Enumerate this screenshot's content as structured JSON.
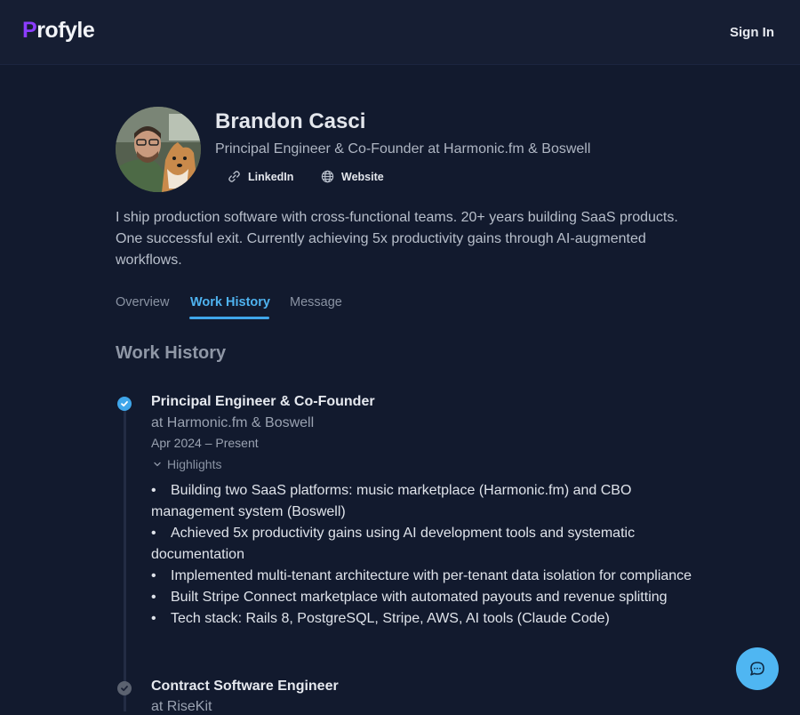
{
  "header": {
    "logo_first": "P",
    "logo_rest": "rofyle",
    "signin_label": "Sign In"
  },
  "profile": {
    "name": "Brandon Casci",
    "role": "Principal Engineer & Co-Founder at Harmonic.fm & Boswell",
    "links": [
      {
        "label": "LinkedIn",
        "icon": "link-icon"
      },
      {
        "label": "Website",
        "icon": "globe-icon"
      }
    ],
    "bio": "I ship production software with cross-functional teams. 20+ years building SaaS products. One successful exit. Currently achieving 5x productivity gains through AI-augmented workflows."
  },
  "tabs": [
    {
      "label": "Overview",
      "active": false
    },
    {
      "label": "Work History",
      "active": true
    },
    {
      "label": "Message",
      "active": false
    }
  ],
  "work_history": {
    "title": "Work History",
    "jobs": [
      {
        "title": "Principal Engineer & Co-Founder",
        "company": "at Harmonic.fm & Boswell",
        "dates": "Apr 2024 – Present",
        "highlights_label": "Highlights",
        "status_icon": "check-circle-icon",
        "highlights": [
          "Building two SaaS platforms: music marketplace (Harmonic.fm) and CBO management system (Boswell)",
          "Achieved 5x productivity gains using AI development tools and systematic documentation",
          "Implemented multi-tenant architecture with per-tenant data isolation for compliance",
          "Built Stripe Connect marketplace with automated payouts and revenue splitting",
          "Tech stack: Rails 8, PostgreSQL, Stripe, AWS, AI tools (Claude Code)"
        ]
      },
      {
        "title": "Contract Software Engineer",
        "company": "at RiseKit",
        "status_icon": "check-circle-icon"
      }
    ]
  },
  "colors": {
    "background": "#121a2e",
    "header": "#161e33",
    "accent": "#4fb3f0",
    "logo_accent": "#8b3dff"
  },
  "chat": {
    "icon": "chat-bubble-icon"
  }
}
